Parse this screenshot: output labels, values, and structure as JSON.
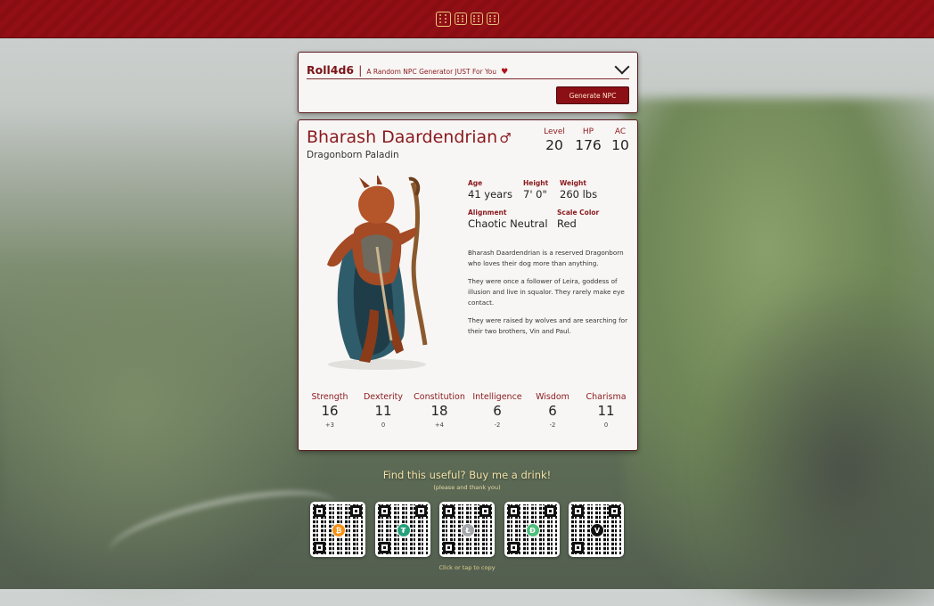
{
  "colors": {
    "accent": "#8a1a1f",
    "topbar": "#8a0d13",
    "button": "#8c0f15",
    "support_text": "#f2e2a8"
  },
  "topbar": {
    "dice_icons": [
      "dice-d6-icon",
      "dice-d6-icon",
      "dice-d6-icon",
      "dice-d6-icon"
    ]
  },
  "generator": {
    "brand": "Roll4d6",
    "separator": "|",
    "tagline": "A Random NPC Generator JUST For You",
    "heart_icon": "heart-icon",
    "toggle_icon": "chevron-down-icon",
    "button_label": "Generate NPC"
  },
  "npc": {
    "name": "Bharash Daardendrian",
    "gender_symbol": "♂",
    "race_class": "Dragonborn Paladin",
    "level_label": "Level",
    "level": "20",
    "hp_label": "HP",
    "hp": "176",
    "ac_label": "AC",
    "ac": "10",
    "age_label": "Age",
    "age": "41 years",
    "height_label": "Height",
    "height": "7' 0\"",
    "weight_label": "Weight",
    "weight": "260 lbs",
    "alignment_label": "Alignment",
    "alignment": "Chaotic Neutral",
    "scale_label": "Scale Color",
    "scale": "Red",
    "description": [
      "Bharash Daardendrian is a reserved Dragonborn who loves their dog more than anything.",
      "They were once a follower of Leira, goddess of illusion and live in squalor. They rarely make eye contact.",
      "They were raised by wolves and are searching for their two brothers, Vin and Paul."
    ],
    "abilities": [
      {
        "label": "Strength",
        "score": "16",
        "mod": "+3"
      },
      {
        "label": "Dexterity",
        "score": "11",
        "mod": "0"
      },
      {
        "label": "Constitution",
        "score": "18",
        "mod": "+4"
      },
      {
        "label": "Intelligence",
        "score": "6",
        "mod": "-2"
      },
      {
        "label": "Wisdom",
        "score": "6",
        "mod": "-2"
      },
      {
        "label": "Charisma",
        "score": "11",
        "mod": "0"
      }
    ]
  },
  "support": {
    "heading": "Find this useful? Buy me a drink!",
    "sub": "(please and thank you)",
    "qr_codes": [
      {
        "icon": "bitcoin-icon",
        "glyph": "₿",
        "color": "#f7931a"
      },
      {
        "icon": "tether-icon",
        "glyph": "₮",
        "color": "#26a17b"
      },
      {
        "icon": "litecoin-icon",
        "glyph": "Ł",
        "color": "#a5a9ad"
      },
      {
        "icon": "dogecoin-icon",
        "glyph": "Ð",
        "color": "#4fbf7a"
      },
      {
        "icon": "venmo-icon",
        "glyph": "V",
        "color": "#111111"
      }
    ],
    "copy_note": "Click or tap to copy"
  }
}
